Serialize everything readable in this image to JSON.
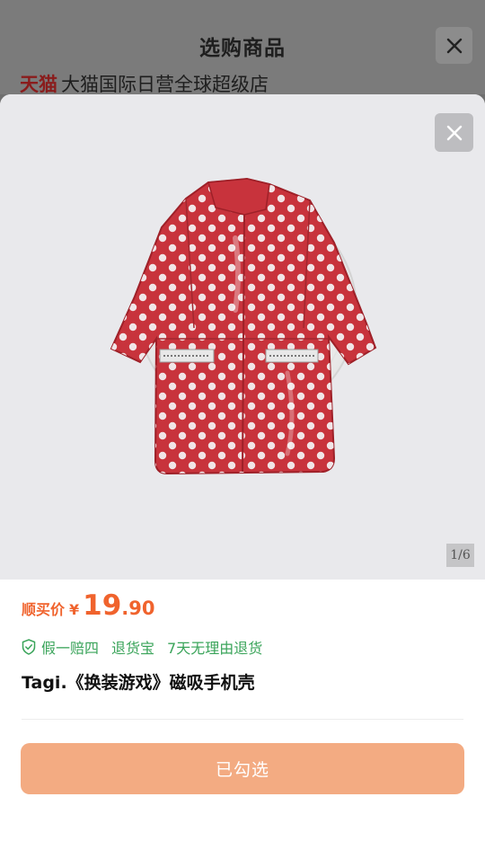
{
  "background_page": {
    "title": "选购商品",
    "store_logo": "天猫",
    "store_name": "大猫国际日营全球超级店"
  },
  "gallery": {
    "counter": "1/6",
    "image_subject": "red-polka-dot-raincoat-phone-grip"
  },
  "product": {
    "price_label": "顺买价",
    "currency": "¥",
    "price_int": "19",
    "price_dec": ".90",
    "guarantees": [
      "假一赔四",
      "退货宝",
      "7天无理由退货"
    ],
    "title": "Tagi.《换装游戏》磁吸手机壳"
  },
  "actions": {
    "select_label": "已勾选"
  },
  "colors": {
    "accent": "#f0632d",
    "button": "#f3ab82",
    "guarantee_green": "#3aa45a",
    "coat_red": "#c8333c"
  },
  "icons": {
    "close": "close-icon",
    "shield": "shield-check-icon"
  }
}
